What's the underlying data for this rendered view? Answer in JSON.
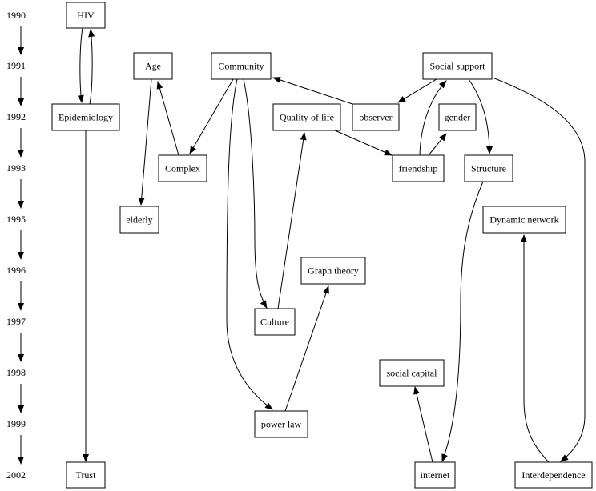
{
  "years": [
    "1990",
    "1991",
    "1992",
    "1993",
    "1995",
    "1996",
    "1997",
    "1998",
    "1999",
    "2002"
  ],
  "nodes": {
    "hiv": "HIV",
    "age": "Age",
    "community": "Community",
    "social_support": "Social support",
    "epidemiology": "Epidemiology",
    "quality_of_life": "Quality of life",
    "observer": "observer",
    "gender": "gender",
    "complex": "Complex",
    "friendship": "friendship",
    "structure": "Structure",
    "elderly": "elderly",
    "dynamic_network": "Dynamic network",
    "graph_theory": "Graph theory",
    "culture": "Culture",
    "social_capital": "social capital",
    "power_law": "power law",
    "trust": "Trust",
    "internet": "internet",
    "interdependence": "Interdependence"
  },
  "edges": [
    {
      "from": "hiv",
      "to": "epidemiology"
    },
    {
      "from": "epidemiology",
      "to": "hiv"
    },
    {
      "from": "age",
      "to": "elderly"
    },
    {
      "from": "complex",
      "to": "age"
    },
    {
      "from": "community",
      "to": "complex"
    },
    {
      "from": "community",
      "to": "power_law"
    },
    {
      "from": "community",
      "to": "culture"
    },
    {
      "from": "observer",
      "to": "community"
    },
    {
      "from": "social_support",
      "to": "observer"
    },
    {
      "from": "friendship",
      "to": "social_support"
    },
    {
      "from": "friendship",
      "to": "gender"
    },
    {
      "from": "social_support",
      "to": "structure"
    },
    {
      "from": "social_support",
      "to": "interdependence"
    },
    {
      "from": "quality_of_life",
      "to": "friendship"
    },
    {
      "from": "culture",
      "to": "quality_of_life"
    },
    {
      "from": "epidemiology",
      "to": "trust"
    },
    {
      "from": "structure",
      "to": "internet"
    },
    {
      "from": "internet",
      "to": "social_capital"
    },
    {
      "from": "power_law",
      "to": "graph_theory"
    },
    {
      "from": "interdependence",
      "to": "dynamic_network"
    }
  ],
  "colors": {
    "stroke": "#000000",
    "fill": "#ffffff"
  }
}
